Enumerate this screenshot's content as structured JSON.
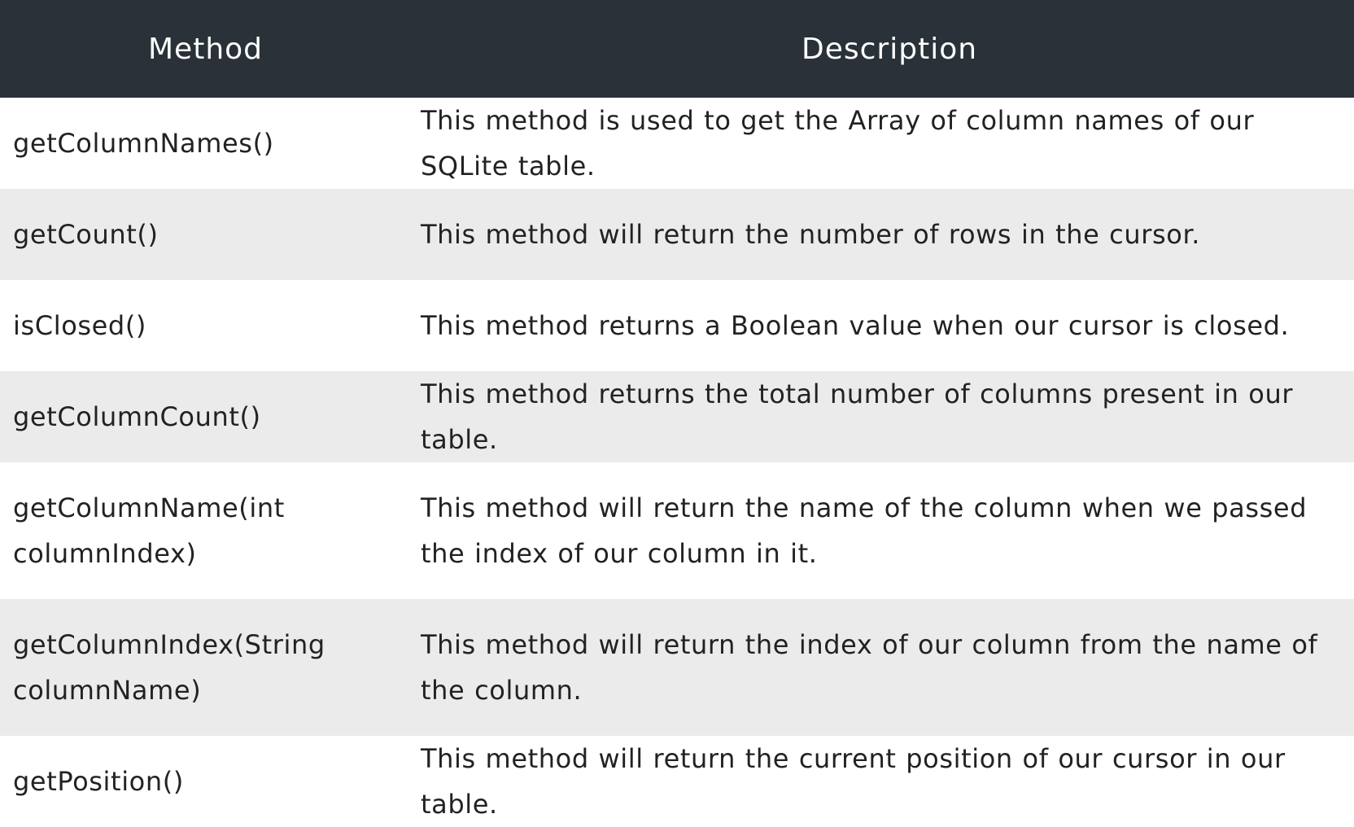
{
  "table": {
    "headers": {
      "method": "Method",
      "description": "Description"
    },
    "rows": [
      {
        "method": "getColumnNames()",
        "description": "This method is used to get the Array of column names of our SQLite table."
      },
      {
        "method": "getCount()",
        "description": "This method will return the number of rows in the cursor."
      },
      {
        "method": "isClosed()",
        "description": "This method returns a Boolean value when our cursor is closed."
      },
      {
        "method": "getColumnCount()",
        "description": "This method returns the total number of columns present in our table."
      },
      {
        "method": "getColumnName(int columnIndex)",
        "description": "This method will return the name of the column when we passed the index of our column in it."
      },
      {
        "method": "getColumnIndex(String columnName)",
        "description": "This method will return the index of our column from the name of the column."
      },
      {
        "method": "getPosition()",
        "description": "This method will return the current position of our cursor in our table."
      }
    ]
  },
  "colors": {
    "header_background": "#2a3139",
    "header_text": "#ffffff",
    "row_alt_background": "#ebebeb",
    "body_text": "#222222"
  }
}
